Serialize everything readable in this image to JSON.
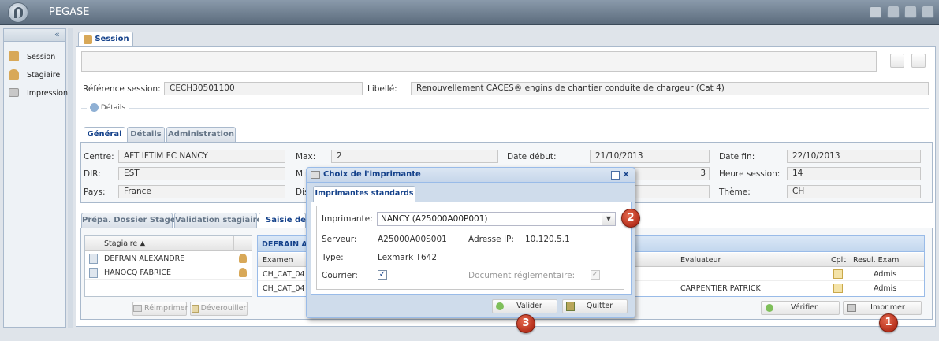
{
  "app": {
    "title": "PEGASE"
  },
  "sidebar": {
    "collapse_glyph": "«",
    "items": [
      {
        "label": "Session",
        "icon": "session-icon"
      },
      {
        "label": "Stagiaire",
        "icon": "stagiaire-icon"
      },
      {
        "label": "Impression",
        "icon": "printer-icon"
      }
    ]
  },
  "main_tab": {
    "label": "Session"
  },
  "session": {
    "reference_label": "Référence session:",
    "reference_value": "CECH30501100",
    "libelle_label": "Libellé:",
    "libelle_value": "Renouvellement CACES® engins de chantier conduite de chargeur (Cat 4)",
    "details_toggle": "Détails"
  },
  "sub_tabs": [
    "Général",
    "Détails",
    "Administration"
  ],
  "general": {
    "centre_label": "Centre:",
    "centre_value": "AFT IFTIM FC NANCY",
    "dir_label": "DIR:",
    "dir_value": "EST",
    "pays_label": "Pays:",
    "pays_value": "France",
    "max_label": "Max:",
    "max_value": "2",
    "min_label_partial": "Mir",
    "dis_label_partial": "Dis",
    "date_debut_label": "Date début:",
    "date_debut_value": "21/10/2013",
    "date_fin_label": "Date fin:",
    "date_fin_value": "22/10/2013",
    "heure_label": "Heure session:",
    "heure_value": "14",
    "theme_label": "Thème:",
    "theme_value": "CH",
    "hidden_value_partial": "3"
  },
  "lower_tabs": [
    "Prépa. Dossier Stage",
    "Validation stagiaire",
    "Saisie des"
  ],
  "stagiaires": {
    "header": "Stagiaire ▲",
    "rows": [
      "DEFRAIN ALEXANDRE",
      "HANOCQ FABRICE"
    ]
  },
  "exam_panel": {
    "title_partial": "DEFRAIN ALI",
    "col_examen": "Examen",
    "col_evaluateur": "Evaluateur",
    "col_cplt": "Cplt",
    "col_result": "Resul. Exam",
    "rows": [
      {
        "examen": "CH_CAT_04",
        "evaluateur": "",
        "result": "Admis"
      },
      {
        "examen": "CH_CAT_04",
        "evaluateur": "CARPENTIER PATRICK",
        "result": "Admis"
      }
    ]
  },
  "buttons": {
    "reimprimer": "Réimprimer",
    "deverouiller": "Déverouiller",
    "verifier": "Vérifier",
    "imprimer": "Imprimer"
  },
  "dialog": {
    "title": "Choix de l'imprimante",
    "tab": "Imprimantes standards",
    "imprimante_label": "Imprimante:",
    "imprimante_value": "NANCY (A25000A00P001)",
    "serveur_label": "Serveur:",
    "serveur_value": "A25000A00S001",
    "ip_label": "Adresse IP:",
    "ip_value": "10.120.5.1",
    "type_label": "Type:",
    "type_value": "Lexmark T642",
    "courrier_label": "Courrier:",
    "doc_label": "Document réglementaire:",
    "valider": "Valider",
    "quitter": "Quitter"
  },
  "badges": [
    "1",
    "2",
    "3"
  ],
  "colors": {
    "titlebar": "#4a5a6a",
    "accent": "#15428b",
    "badge": "#c0392b"
  }
}
